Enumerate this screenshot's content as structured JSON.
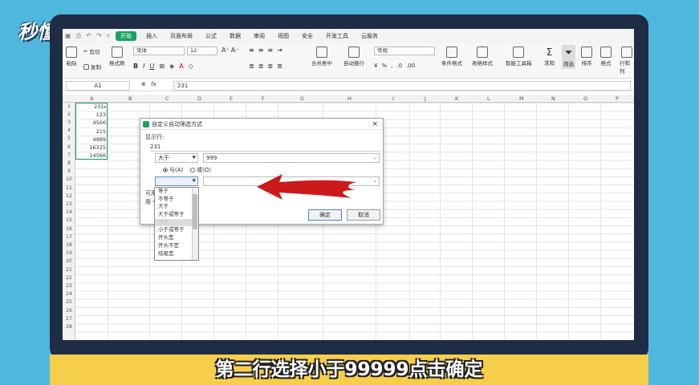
{
  "logo": "秒懂视频",
  "tabs": [
    "开始",
    "插入",
    "页面布局",
    "公式",
    "数据",
    "审阅",
    "视图",
    "安全",
    "开发工具",
    "云服务"
  ],
  "ribbon": {
    "paste": "粘贴",
    "cut": "剪切",
    "copy": "复制",
    "format_painter": "格式刷",
    "font_name": "宋体",
    "font_size": "12",
    "merge_center": "合并居中",
    "wrap_text": "自动换行",
    "number_format": "常规",
    "cond_format": "条件格式",
    "table_style": "表格样式",
    "smart_toolbox": "智能工具箱",
    "sum": "求和",
    "filter": "筛选",
    "sort": "排序",
    "format": "格式",
    "row_col": "行和列"
  },
  "formula_bar": {
    "cell_ref": "A1",
    "fx": "fx",
    "value": "231"
  },
  "columns": [
    "A",
    "B",
    "C",
    "D",
    "E",
    "F",
    "G",
    "H",
    "I",
    "J",
    "K",
    "L",
    "M",
    "N",
    "O",
    "P"
  ],
  "rows": [
    "1",
    "2",
    "3",
    "4",
    "5",
    "6",
    "7",
    "8",
    "9",
    "10",
    "11",
    "12",
    "13",
    "14",
    "15",
    "16",
    "17",
    "18",
    "19",
    "20",
    "21",
    "22",
    "23",
    "24",
    "25",
    "26",
    "27",
    "28"
  ],
  "cells_a": [
    "231",
    "123",
    "4566",
    "215",
    "4989",
    "16325",
    "14566"
  ],
  "side_text": [
    "可用",
    "用 *"
  ],
  "dialog": {
    "title": "自定义自动筛选方式",
    "show_rows": "显示行:",
    "field": "231",
    "op1": "大于",
    "val1": "999",
    "and_label": "与(A)",
    "or_label": "或(O)",
    "op2": "",
    "val2": "",
    "ok": "确定",
    "cancel": "取消",
    "close": "×"
  },
  "dropdown_items": [
    "等于",
    "不等于",
    "大于",
    "大于或等于",
    "小于",
    "小于或等于",
    "开头是",
    "开头不是",
    "结尾是"
  ],
  "caption": "第二行选择小于99999点击确定"
}
